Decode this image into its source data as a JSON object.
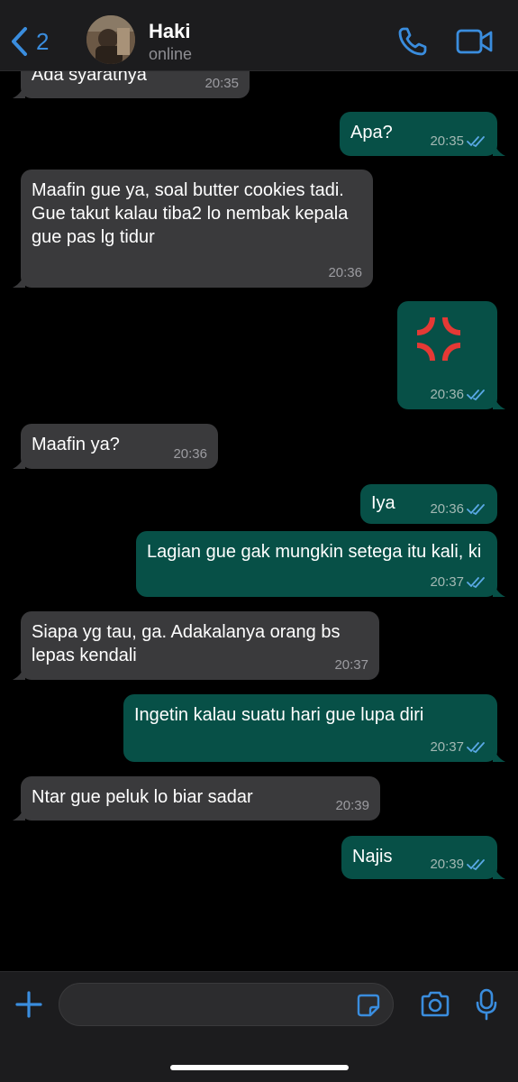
{
  "header": {
    "back_count": "2",
    "contact_name": "Haki",
    "contact_status": "online"
  },
  "messages": [
    {
      "direction": "incoming",
      "text": "Ada syaratnya",
      "time": "20:35"
    },
    {
      "direction": "outgoing",
      "text": "Apa?",
      "time": "20:35",
      "read": true
    },
    {
      "direction": "incoming",
      "text": "Maafin gue ya, soal butter cookies tadi. Gue takut kalau tiba2 lo nembak kepala gue pas lg tidur",
      "time": "20:36"
    },
    {
      "direction": "outgoing",
      "emoji": "anger-symbol",
      "time": "20:36",
      "read": true
    },
    {
      "direction": "incoming",
      "text": "Maafin ya?",
      "time": "20:36"
    },
    {
      "direction": "outgoing",
      "text": "Iya",
      "time": "20:36",
      "read": true
    },
    {
      "direction": "outgoing",
      "text": "Lagian gue gak mungkin setega itu kali, ki",
      "time": "20:37",
      "read": true
    },
    {
      "direction": "incoming",
      "text": "Siapa yg tau, ga. Adakalanya orang bs lepas kendali",
      "time": "20:37"
    },
    {
      "direction": "outgoing",
      "text": "Ingetin kalau suatu hari gue lupa diri",
      "time": "20:37",
      "read": true
    },
    {
      "direction": "incoming",
      "text": "Ntar gue peluk lo biar sadar",
      "time": "20:39"
    },
    {
      "direction": "outgoing",
      "text": "Najis",
      "time": "20:39",
      "read": true
    }
  ],
  "composer": {
    "placeholder": ""
  },
  "colors": {
    "accent": "#3a8dde",
    "incoming_bubble": "#3a3a3c",
    "outgoing_bubble": "#075047",
    "read_ticks": "#5aa9e6",
    "anger_symbol": "#e53935"
  },
  "icons": {
    "back": "chevron-left-icon",
    "call": "phone-icon",
    "video": "video-camera-icon",
    "attach": "plus-icon",
    "sticker": "sticker-icon",
    "camera": "camera-icon",
    "mic": "microphone-icon"
  }
}
